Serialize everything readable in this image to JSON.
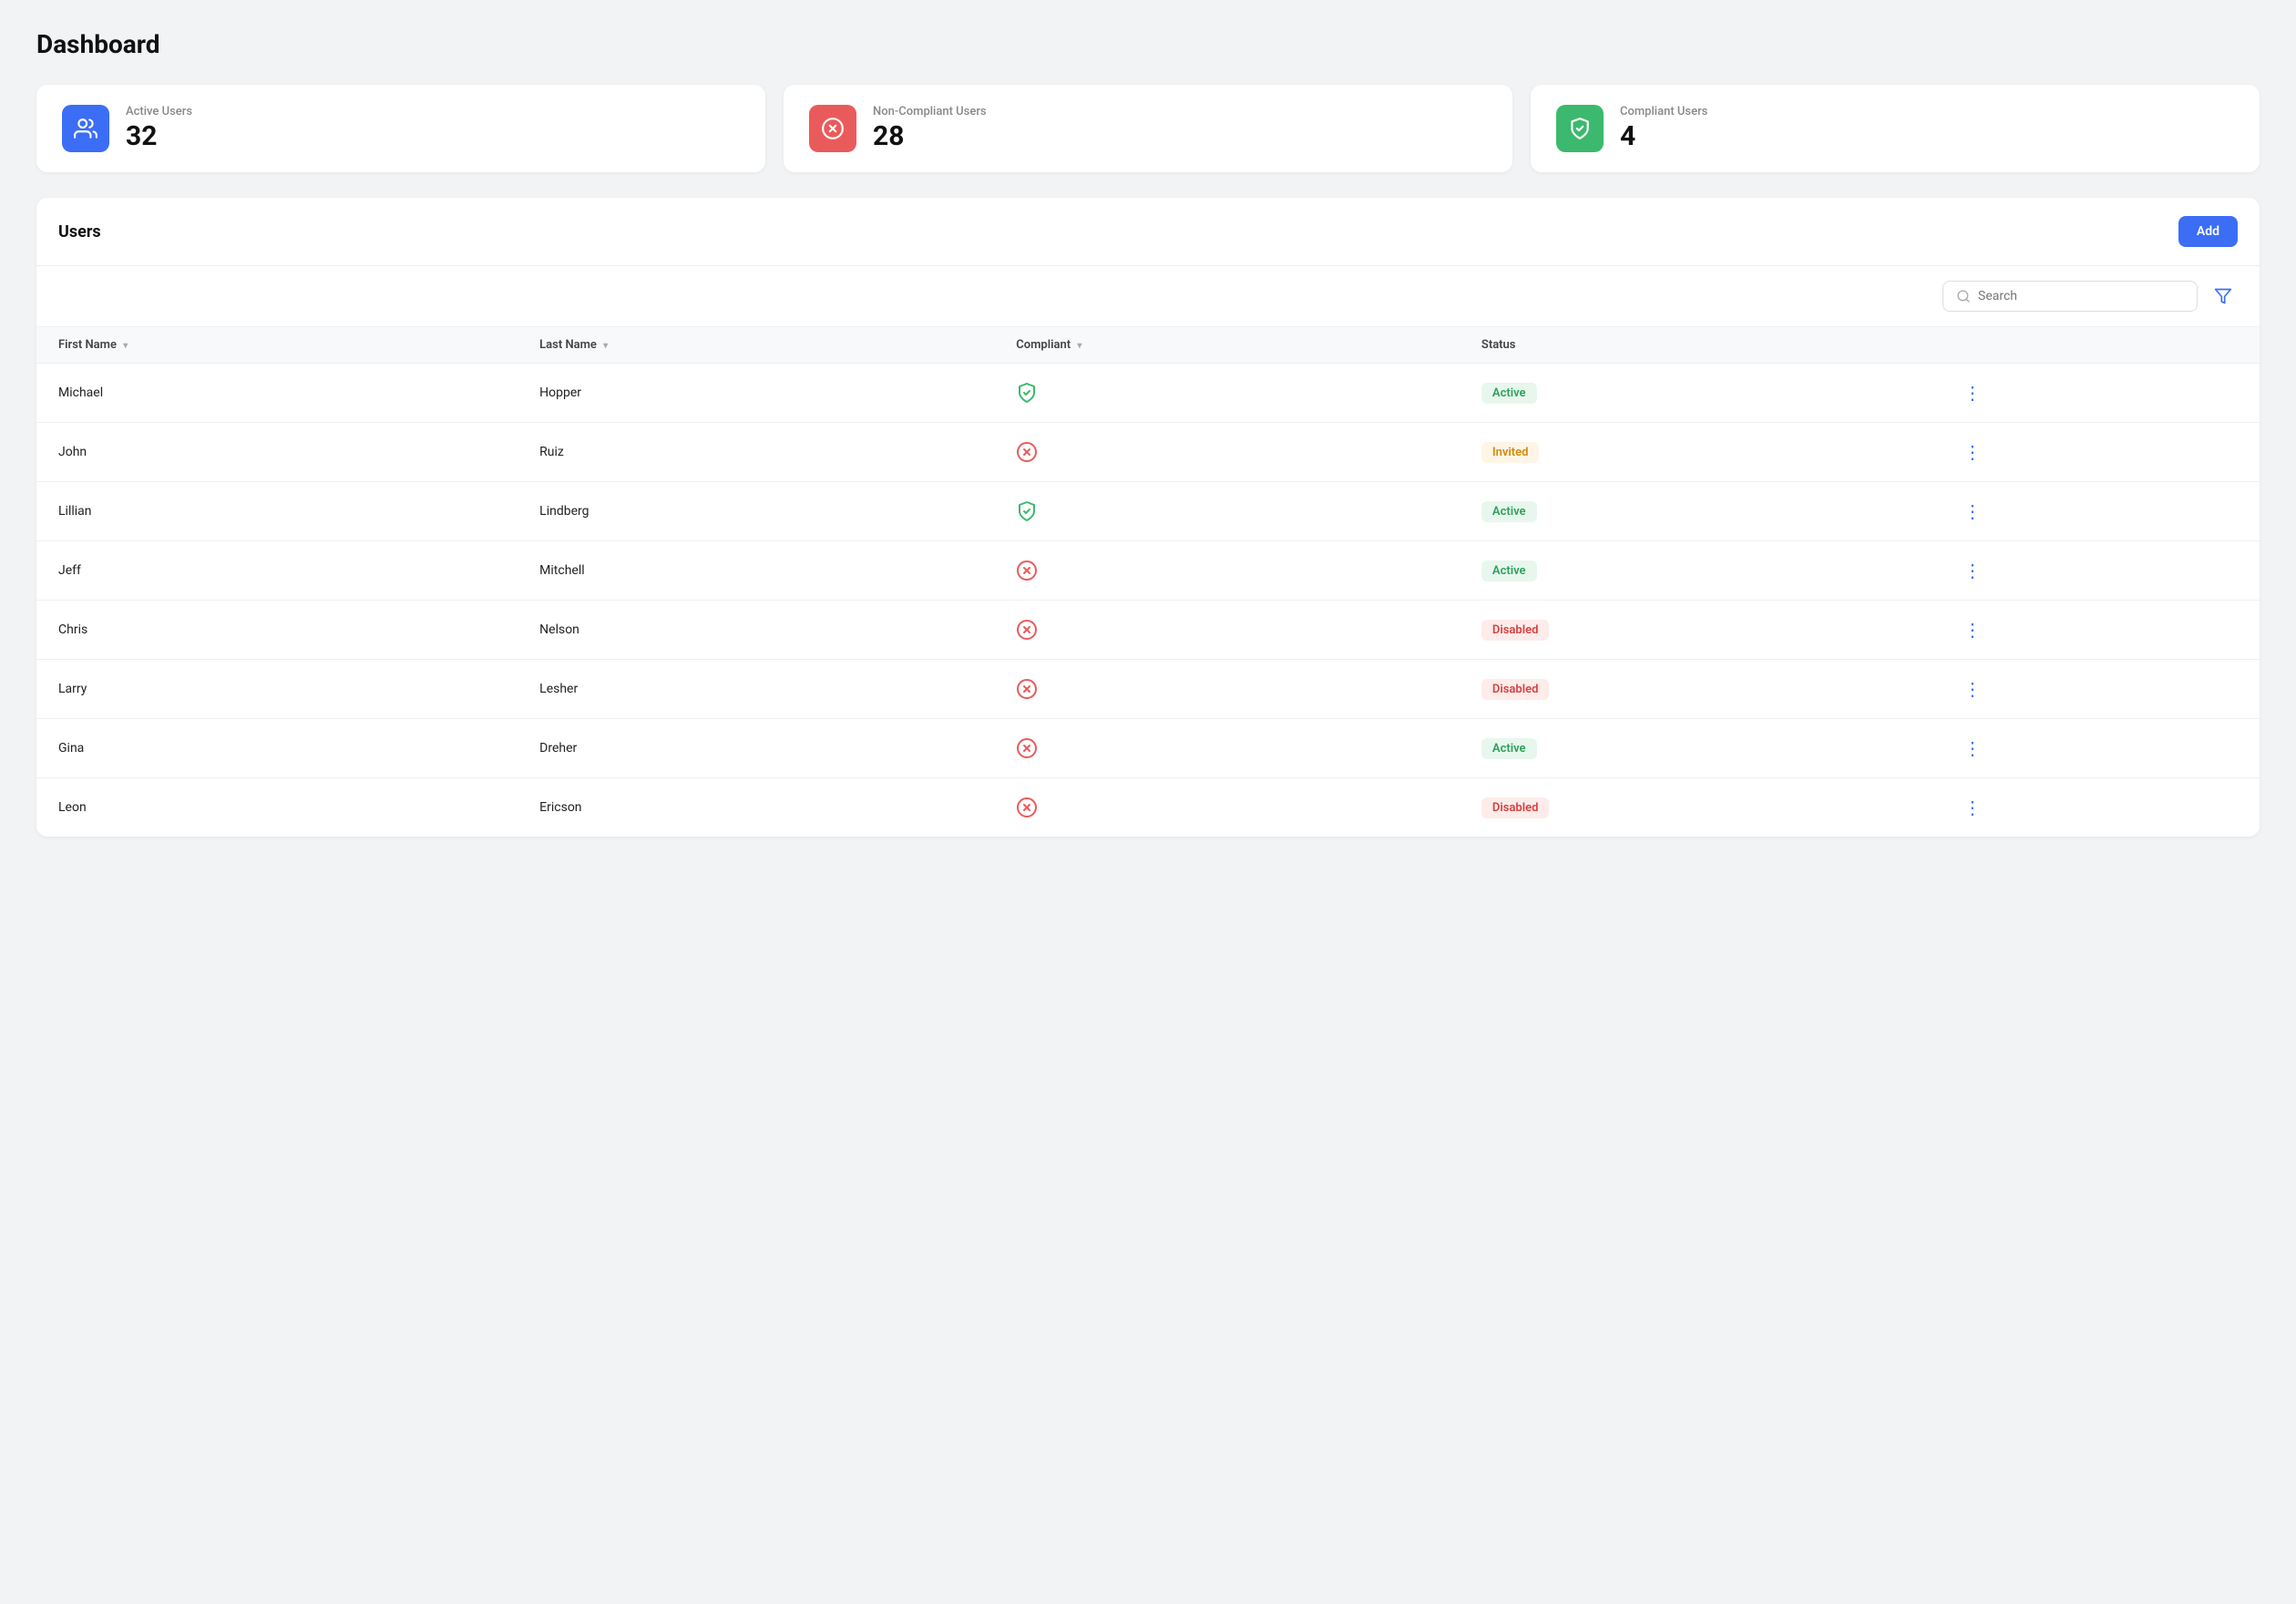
{
  "page": {
    "title": "Dashboard"
  },
  "stats": [
    {
      "id": "active-users",
      "label": "Active Users",
      "value": "32",
      "icon_type": "users",
      "color": "blue"
    },
    {
      "id": "non-compliant-users",
      "label": "Non-Compliant Users",
      "value": "28",
      "icon_type": "x-circle",
      "color": "red"
    },
    {
      "id": "compliant-users",
      "label": "Compliant Users",
      "value": "4",
      "icon_type": "shield",
      "color": "green"
    }
  ],
  "users_section": {
    "title": "Users",
    "add_button": "Add",
    "search_placeholder": "Search",
    "columns": [
      {
        "key": "first_name",
        "label": "First Name"
      },
      {
        "key": "last_name",
        "label": "Last Name"
      },
      {
        "key": "compliant",
        "label": "Compliant"
      },
      {
        "key": "status",
        "label": "Status"
      }
    ],
    "rows": [
      {
        "first_name": "Michael",
        "last_name": "Hopper",
        "compliant": true,
        "status": "Active"
      },
      {
        "first_name": "John",
        "last_name": "Ruiz",
        "compliant": false,
        "status": "Invited"
      },
      {
        "first_name": "Lillian",
        "last_name": "Lindberg",
        "compliant": true,
        "status": "Active"
      },
      {
        "first_name": "Jeff",
        "last_name": "Mitchell",
        "compliant": false,
        "status": "Active"
      },
      {
        "first_name": "Chris",
        "last_name": "Nelson",
        "compliant": false,
        "status": "Disabled"
      },
      {
        "first_name": "Larry",
        "last_name": "Lesher",
        "compliant": false,
        "status": "Disabled"
      },
      {
        "first_name": "Gina",
        "last_name": "Dreher",
        "compliant": false,
        "status": "Active"
      },
      {
        "first_name": "Leon",
        "last_name": "Ericson",
        "compliant": false,
        "status": "Disabled"
      }
    ]
  },
  "colors": {
    "blue": "#3b6ef5",
    "red": "#e95b5b",
    "green": "#3cb96e",
    "active_bg": "#e8f7ee",
    "active_text": "#2ea05a",
    "invited_bg": "#fff5e6",
    "invited_text": "#d48a0a",
    "disabled_bg": "#fdecea",
    "disabled_text": "#d84040"
  }
}
